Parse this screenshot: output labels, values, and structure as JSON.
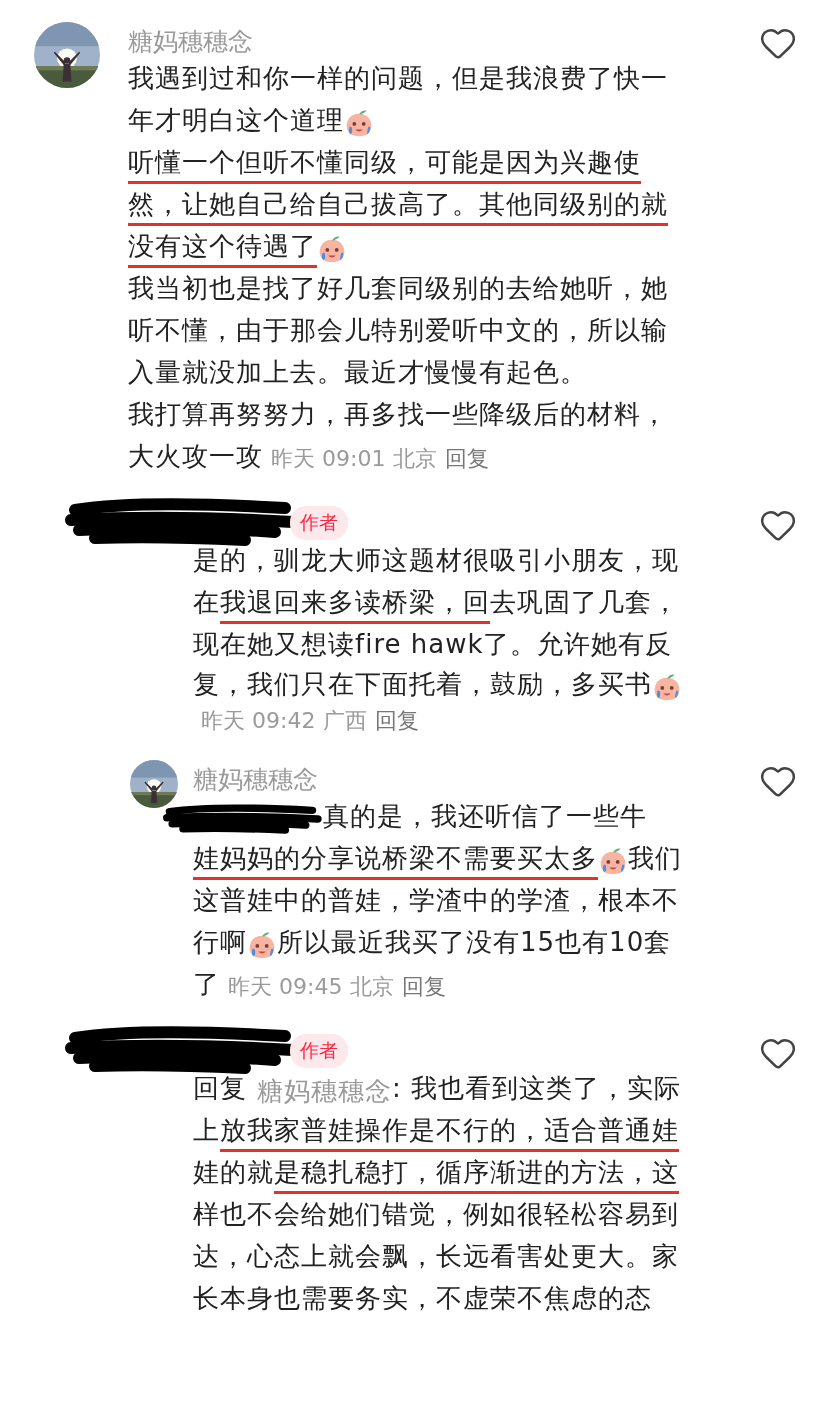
{
  "comments": [
    {
      "avatar": {
        "kind": "picture"
      },
      "name": "糖妈穗穗念",
      "lines": [
        {
          "segments": [
            {
              "kind": "text",
              "text": "我遇到过和你一样的问题，但是我浪费了快一",
              "underlined": false
            }
          ]
        },
        {
          "segments": [
            {
              "kind": "text",
              "text": "年才明白这个道理",
              "underlined": false
            },
            {
              "kind": "emoji"
            }
          ]
        },
        {
          "segments": [
            {
              "kind": "text",
              "text": "听懂一个但听不懂同级，可能是因为兴趣使",
              "underlined": true
            }
          ]
        },
        {
          "segments": [
            {
              "kind": "text",
              "text": "然，让她自己给自己拔高了。其他同级别的就",
              "underlined": true
            }
          ]
        },
        {
          "segments": [
            {
              "kind": "text",
              "text": "没有这个待遇了",
              "underlined": true
            },
            {
              "kind": "emoji"
            }
          ]
        },
        {
          "segments": [
            {
              "kind": "text",
              "text": "我当初也是找了好几套同级别的去给她听，她",
              "underlined": false
            }
          ]
        },
        {
          "segments": [
            {
              "kind": "text",
              "text": "听不懂，由于那会儿特别爱听中文的，所以输",
              "underlined": false
            }
          ]
        },
        {
          "segments": [
            {
              "kind": "text",
              "text": "入量就没加上去。最近才慢慢有起色。",
              "underlined": false
            }
          ]
        },
        {
          "segments": [
            {
              "kind": "text",
              "text": "我打算再努努力，再多找一些降级后的材料，",
              "underlined": false
            }
          ]
        },
        {
          "segments": [
            {
              "kind": "text",
              "text": "大火攻一攻",
              "underlined": false
            }
          ]
        }
      ],
      "meta": {
        "time": "昨天 09:01",
        "location": "北京",
        "reply": "回复"
      },
      "children": [
        {
          "name_redacted": true,
          "badge": "作者",
          "lines": [
            {
              "segments": [
                {
                  "kind": "text",
                  "text": "是的，驯龙大师这题材很吸引小朋友，现",
                  "underlined": false
                }
              ]
            },
            {
              "segments": [
                {
                  "kind": "text",
                  "text": "在",
                  "underlined": false
                },
                {
                  "kind": "text",
                  "text": "我退回来多读桥梁，回",
                  "underlined": true
                },
                {
                  "kind": "text",
                  "text": "去巩固了几套，",
                  "underlined": false
                }
              ]
            },
            {
              "segments": [
                {
                  "kind": "text",
                  "text": "现在她又想读fire hawk了。允许她有反",
                  "underlined": false
                }
              ]
            },
            {
              "segments": [
                {
                  "kind": "text",
                  "text": "复，我们只在下面托着，鼓励，多买书",
                  "underlined": false
                },
                {
                  "kind": "emoji"
                }
              ]
            }
          ],
          "meta": {
            "time": "昨天 09:42",
            "location": "广西",
            "reply": "回复"
          }
        },
        {
          "avatar": {
            "kind": "picture"
          },
          "name": "糖妈穗穗念",
          "lines": [
            {
              "segments": [
                {
                  "kind": "redacted"
                },
                {
                  "kind": "text",
                  "text": "真的是，我还听信了一些牛",
                  "underlined": false
                }
              ]
            },
            {
              "segments": [
                {
                  "kind": "text",
                  "text": "娃妈妈的分享说桥梁不需要买太多",
                  "underlined": true
                },
                {
                  "kind": "emoji"
                },
                {
                  "kind": "text",
                  "text": "我们",
                  "underlined": false
                }
              ]
            },
            {
              "segments": [
                {
                  "kind": "text",
                  "text": "这普娃中的普娃，学渣中的学渣，根本不",
                  "underlined": false
                }
              ]
            },
            {
              "segments": [
                {
                  "kind": "text",
                  "text": "行啊",
                  "underlined": false
                },
                {
                  "kind": "emoji"
                },
                {
                  "kind": "text",
                  "text": "所以最近我买了没有15也有10套",
                  "underlined": false
                }
              ]
            },
            {
              "segments": [
                {
                  "kind": "text",
                  "text": "了",
                  "underlined": false
                }
              ]
            }
          ],
          "meta": {
            "time": "昨天 09:45",
            "location": "北京",
            "reply": "回复"
          }
        },
        {
          "name_redacted": true,
          "badge": "作者",
          "lines": [
            {
              "segments": [
                {
                  "kind": "text",
                  "text": "回复",
                  "underlined": false
                },
                {
                  "kind": "mention",
                  "text": "糖妈穗穗念"
                },
                {
                  "kind": "text",
                  "text": ": 我也看到这类了，实际",
                  "underlined": false
                }
              ]
            },
            {
              "segments": [
                {
                  "kind": "text",
                  "text": "上",
                  "underlined": false
                },
                {
                  "kind": "text",
                  "text": "放我家普娃操作是不行的，适合普通娃",
                  "underlined": true
                }
              ]
            },
            {
              "segments": [
                {
                  "kind": "text",
                  "text": "娃的就",
                  "underlined": false
                },
                {
                  "kind": "text",
                  "text": "是稳扎稳打，循序渐进的方法，这",
                  "underlined": true
                }
              ]
            },
            {
              "segments": [
                {
                  "kind": "text",
                  "text": "样也不会给她们错觉，例如很轻松容易到",
                  "underlined": false
                }
              ]
            },
            {
              "segments": [
                {
                  "kind": "text",
                  "text": "达，心态上就会飘，长远看害处更大。家",
                  "underlined": false
                }
              ]
            },
            {
              "segments": [
                {
                  "kind": "text",
                  "text": "长本身也需要务实，不虚荣不焦虑的态",
                  "underlined": false
                }
              ]
            }
          ]
        }
      ]
    }
  ]
}
